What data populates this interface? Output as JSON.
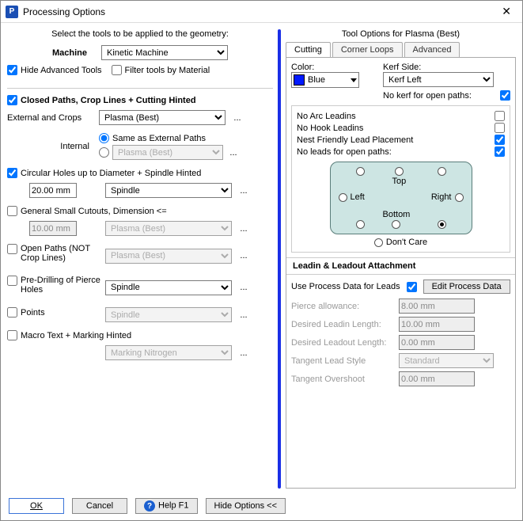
{
  "window": {
    "title": "Processing Options"
  },
  "left": {
    "instruction": "Select the tools to be applied to the geometry:",
    "machine_label": "Machine",
    "machine_value": "Kinetic Machine",
    "hide_adv_label": "Hide Advanced Tools",
    "filter_label": "Filter tools by Material",
    "closed_paths": {
      "heading": "Closed Paths,  Crop Lines  +   Cutting Hinted",
      "external_label": "External and Crops",
      "external_tool": "Plasma (Best)",
      "internal_label": "Internal",
      "same_label": "Same as External Paths",
      "internal_tool": "Plasma (Best)"
    },
    "holes": {
      "heading": "Circular Holes up to Diameter   +  Spindle Hinted",
      "value": "20.00 mm",
      "tool": "Spindle"
    },
    "cutouts": {
      "heading": "General Small Cutouts, Dimension <=",
      "value": "10.00 mm",
      "tool": "Plasma (Best)"
    },
    "openpaths": {
      "heading": "Open Paths  (NOT Crop Lines)",
      "tool": "Plasma (Best)"
    },
    "predrill": {
      "heading": "Pre-Drilling of Pierce Holes",
      "tool": "Spindle"
    },
    "points": {
      "heading": "Points",
      "tool": "Spindle"
    },
    "macro": {
      "heading": "Macro Text   +  Marking Hinted",
      "tool": "Marking Nitrogen"
    }
  },
  "right": {
    "title": "Tool Options for Plasma (Best)",
    "tabs": {
      "cutting": "Cutting",
      "corner": "Corner Loops",
      "advanced": "Advanced"
    },
    "color_label": "Color:",
    "color_value": "Blue",
    "kerf_label": "Kerf Side:",
    "kerf_value": "Kerf Left",
    "nokerf_label": "No kerf for open paths:",
    "noarc_label": "No Arc Leadins",
    "nohook_label": "No Hook Leadins",
    "nest_label": "Nest Friendly Lead Placement",
    "noleads_label": "No leads for open paths:",
    "dir": {
      "top": "Top",
      "left": "Left",
      "right": "Right",
      "bottom": "Bottom",
      "dontcare": "Don't Care"
    },
    "leadsec": "Leadin & Leadout Attachment",
    "useproc_label": "Use Process Data for Leads",
    "editproc_label": "Edit Process Data",
    "params": {
      "pierce_label": "Pierce allowance:",
      "pierce_value": "8.00 mm",
      "leadin_label": "Desired Leadin Length:",
      "leadin_value": "10.00 mm",
      "leadout_label": "Desired Leadout Length:",
      "leadout_value": "0.00 mm",
      "tanstyle_label": "Tangent Lead Style",
      "tanstyle_value": "Standard",
      "overshoot_label": "Tangent Overshoot",
      "overshoot_value": "0.00 mm"
    }
  },
  "footer": {
    "ok": "OK",
    "cancel": "Cancel",
    "help": "Help F1",
    "hide": "Hide Options <<"
  }
}
